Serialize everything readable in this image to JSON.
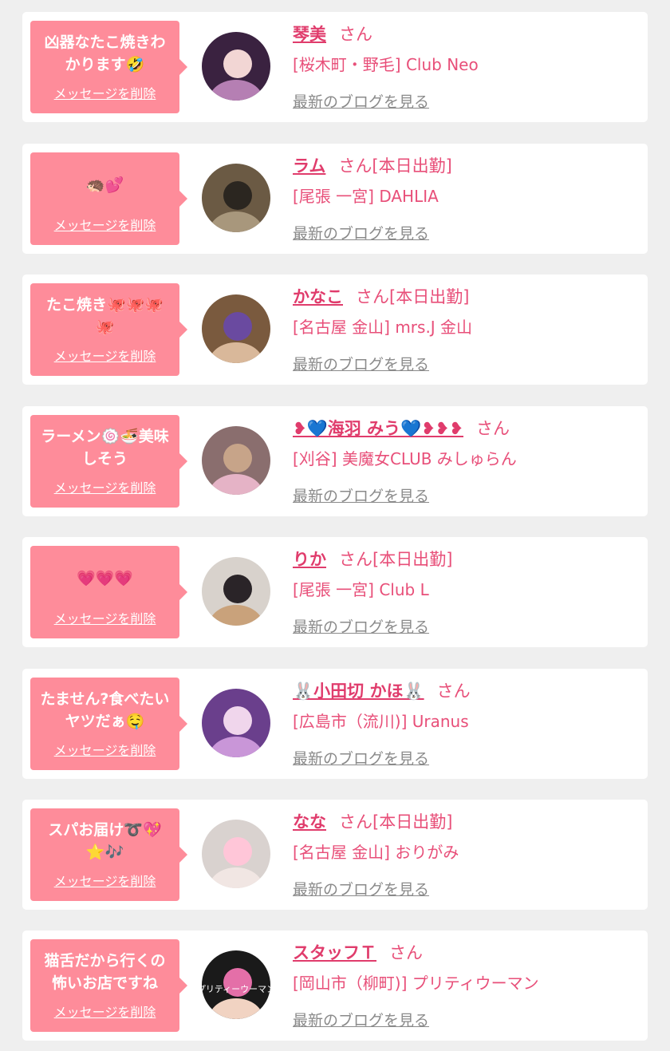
{
  "actions": {
    "delete_label": "メッセージを削除",
    "blog_label": "最新のブログを見る"
  },
  "items": [
    {
      "message": "凶器なたこ焼きわかります🤣",
      "name": "琴美",
      "suffix": "さん",
      "shop": "[桜木町・野毛] Club Neo",
      "avatar_colors": [
        "#3a2240",
        "#b57fb3",
        "#f2d6d4"
      ]
    },
    {
      "message": "🦔💕",
      "name": "ラム",
      "suffix": "さん[本日出勤]",
      "shop": "[尾張 一宮] DAHLIA",
      "avatar_colors": [
        "#6b5a44",
        "#a8977c",
        "#2b2620"
      ]
    },
    {
      "message": "たこ焼き🐙🐙🐙🐙",
      "name": "かなこ",
      "suffix": "さん[本日出勤]",
      "shop": "[名古屋 金山] mrs.J 金山",
      "avatar_colors": [
        "#7a5a3e",
        "#d9b89a",
        "#6a4aa0"
      ]
    },
    {
      "message": "ラーメン🍥🍜美味しそう",
      "name": "❥💙海羽 みう💙❥❥❥",
      "suffix": "さん",
      "shop": "[刈谷] 美魔女CLUB みしゅらん",
      "avatar_colors": [
        "#8a6e6e",
        "#e5b3c6",
        "#c7a489"
      ]
    },
    {
      "message": "💗💗💗",
      "name": "りか",
      "suffix": "さん[本日出勤]",
      "shop": "[尾張 一宮] Club L",
      "avatar_colors": [
        "#d8d2cc",
        "#c9a27b",
        "#2a2428"
      ]
    },
    {
      "message": "たません?食べたいヤツだぁ🤤",
      "name": "🐰小田切 かほ🐰",
      "suffix": "さん",
      "shop": "[広島市（流川)] Uranus",
      "avatar_colors": [
        "#6a3f8c",
        "#c996d8",
        "#f0d6ec"
      ]
    },
    {
      "message": "スパお届け➰💖⭐🎶",
      "name": "なな",
      "suffix": "さん[本日出勤]",
      "shop": "[名古屋 金山] おりがみ",
      "avatar_colors": [
        "#d9d2cf",
        "#f1e6e3",
        "#ffc6d8"
      ]
    },
    {
      "message": "猫舌だから行くの怖いお店ですね",
      "name": "スタッフＴ",
      "suffix": "さん",
      "shop": "[岡山市（柳町)] プリティウーマン",
      "avatar_colors": [
        "#1a1a1a",
        "#f1d3c2",
        "#e46fa8"
      ],
      "avatar_text": "プリティーウーマン"
    }
  ]
}
